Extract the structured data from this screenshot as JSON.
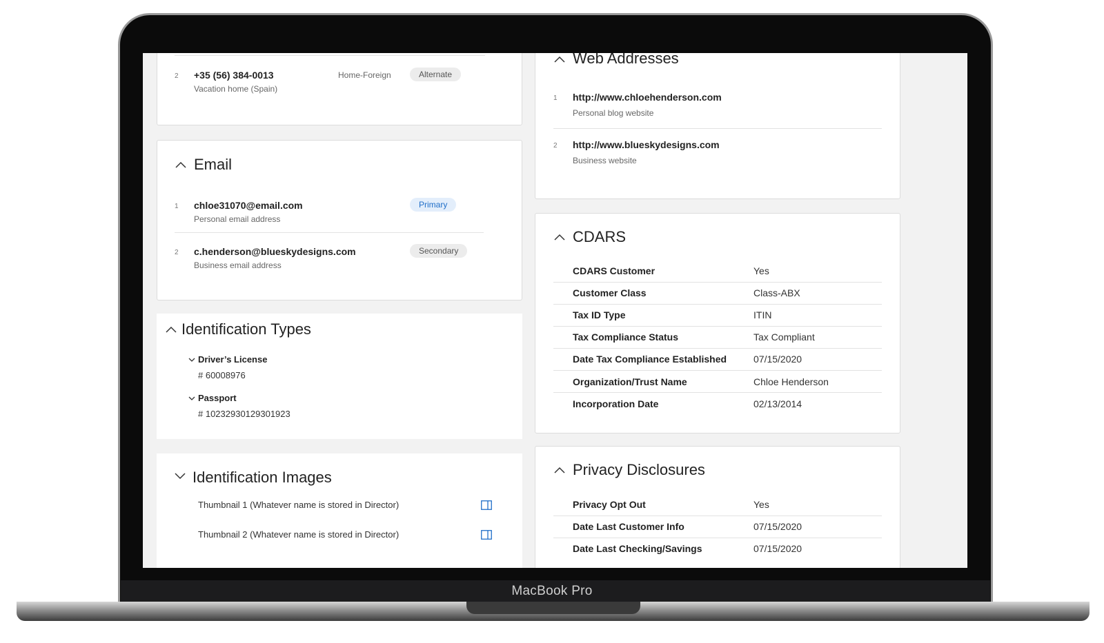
{
  "device": {
    "brand_label": "MacBook Pro"
  },
  "phone": {
    "entry": {
      "index": "2",
      "number": "+35 (56) 384-0013",
      "description": "Vacation home (Spain)",
      "type": "Home-Foreign",
      "tag": "Alternate"
    }
  },
  "email": {
    "title": "Email",
    "items": [
      {
        "index": "1",
        "address": "chloe31070@email.com",
        "description": "Personal email address",
        "tag": "Primary"
      },
      {
        "index": "2",
        "address": "c.henderson@blueskydesigns.com",
        "description": "Business email address",
        "tag": "Secondary"
      }
    ]
  },
  "identification_types": {
    "title": "Identification Types",
    "items": [
      {
        "label": "Driver’s License",
        "number": "# 60008976"
      },
      {
        "label": "Passport",
        "number": "# 10232930129301923"
      }
    ]
  },
  "identification_images": {
    "title": "Identification Images",
    "items": [
      {
        "label": "Thumbnail 1 (Whatever name is stored in Director)"
      },
      {
        "label": "Thumbnail 2 (Whatever name is stored in Director)"
      }
    ]
  },
  "web_addresses": {
    "title": "Web Addresses",
    "items": [
      {
        "index": "1",
        "url": "http://www.chloehenderson.com",
        "description": "Personal blog website"
      },
      {
        "index": "2",
        "url": "http://www.blueskydesigns.com",
        "description": "Business website"
      }
    ]
  },
  "cdars": {
    "title": "CDARS",
    "rows": [
      {
        "label": "CDARS Customer",
        "value": "Yes"
      },
      {
        "label": "Customer Class",
        "value": "Class-ABX"
      },
      {
        "label": "Tax ID Type",
        "value": "ITIN"
      },
      {
        "label": "Tax Compliance Status",
        "value": "Tax Compliant"
      },
      {
        "label": "Date Tax Compliance Established",
        "value": "07/15/2020"
      },
      {
        "label": "Organization/Trust Name",
        "value": "Chloe Henderson"
      },
      {
        "label": "Incorporation Date",
        "value": "02/13/2014"
      }
    ]
  },
  "privacy": {
    "title": "Privacy Disclosures",
    "rows": [
      {
        "label": "Privacy Opt Out",
        "value": "Yes"
      },
      {
        "label": "Date Last Customer Info",
        "value": "07/15/2020"
      },
      {
        "label": "Date Last Checking/Savings",
        "value": "07/15/2020"
      }
    ]
  },
  "colors": {
    "accent": "#1f6ec8",
    "primary_tag_bg": "#e3eefb",
    "neutral_tag_bg": "#ececec",
    "panel_bg": "#f2f2f2"
  }
}
